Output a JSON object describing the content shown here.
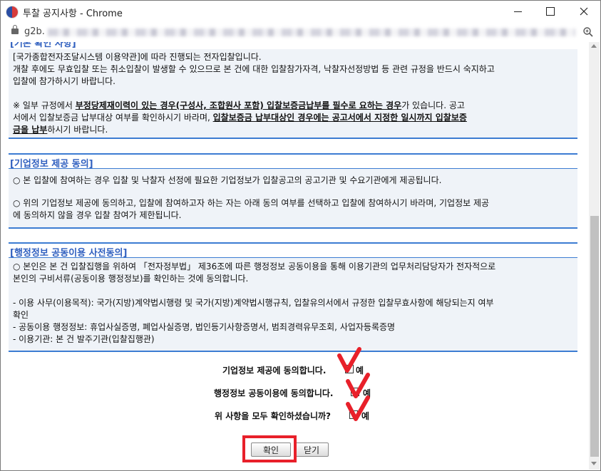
{
  "window": {
    "title": "투찰 공지사항 - Chrome"
  },
  "address": {
    "visible_prefix": "g2b."
  },
  "intro": {
    "heading_partial": "[기본 확인 사항]",
    "line1": "[국가종합전자조달시스템 이용약관]에 따라 진행되는 전자입찰입니다.",
    "line2": "개찰 후에도 무효입찰 또는 취소입찰이 발생할 수 있으므로 본 건에 대한 입찰참가자격, 낙찰자선정방법 등 관련 규정을 반드시 숙지하고",
    "line3": "입찰에 참가하시기 바랍니다.",
    "line4_a": "※ 일부 규정에서 ",
    "line4_b": "부정당제재이력이 있는 경우(구성사, 조합원사 포함) 입찰보증금납부를 필수로 요하는 경우",
    "line4_c": "가 있습니다. 공고",
    "line5_a": "서에서 입찰보증금 납부대상 여부를 확인하시기 바라며, ",
    "line5_b": "입찰보증금 납부대상인 경우에는 공고서에서 지정한 일시까지 입찰보증",
    "line6_a": "금을 납부",
    "line6_b": "하시기 바랍니다."
  },
  "corp_section": {
    "title": "[기업정보 제공 동의]",
    "line1": "○ 본 입찰에 참여하는 경우 입찰 및 낙찰자 선정에 필요한 기업정보가 입찰공고의 공고기관 및 수요기관에게 제공됩니다.",
    "line2": "○ 위의 기업정보 제공에 동의하고, 입찰에 참여하고자 하는 자는 아래 동의 여부를 선택하고 입찰에 참여하시기 바라며, 기업정보 제공",
    "line3": "에 동의하지 않을 경우 입찰 참여가 제한됩니다."
  },
  "admin_section": {
    "title": "[행정정보 공동이용 사전동의]",
    "line1": "○ 본인은 본 건 입찰집행을 위하여 「전자정부법」 제36조에 따른 행정정보 공동이용을 통해 이용기관의 업무처리담당자가 전자적으로",
    "line2": "본인의 구비서류(공동이용 행정정보)를 확인하는 것에 동의합니다.",
    "line3": "- 이용 사무(이용목적): 국가(지방)계약법시행령 및 국가(지방)계약법시행규칙, 입찰유의서에서 규정한 입찰무효사항에 해당되는지 여부",
    "line4": "확인",
    "line5": "- 공동이용 행정정보: 휴업사실증명, 폐업사실증명, 법인등기사항증명서, 범죄경력유무조회, 사업자등록증명",
    "line6": "- 이용기관: 본 건 발주기관(입찰집행관)"
  },
  "agreements": [
    {
      "label": "기업정보 제공에 동의합니다.",
      "checkbox_label": "예"
    },
    {
      "label": "행정정보 공동이용에 동의합니다.",
      "checkbox_label": "예"
    },
    {
      "label": "위 사항을 모두 확인하셨습니까?",
      "checkbox_label": "예"
    }
  ],
  "buttons": {
    "confirm": "확인",
    "close": "닫기"
  },
  "colors": {
    "accent_blue": "#3c7cd2",
    "section_title": "#2f5fbf",
    "annotation_red": "#e8202a"
  }
}
